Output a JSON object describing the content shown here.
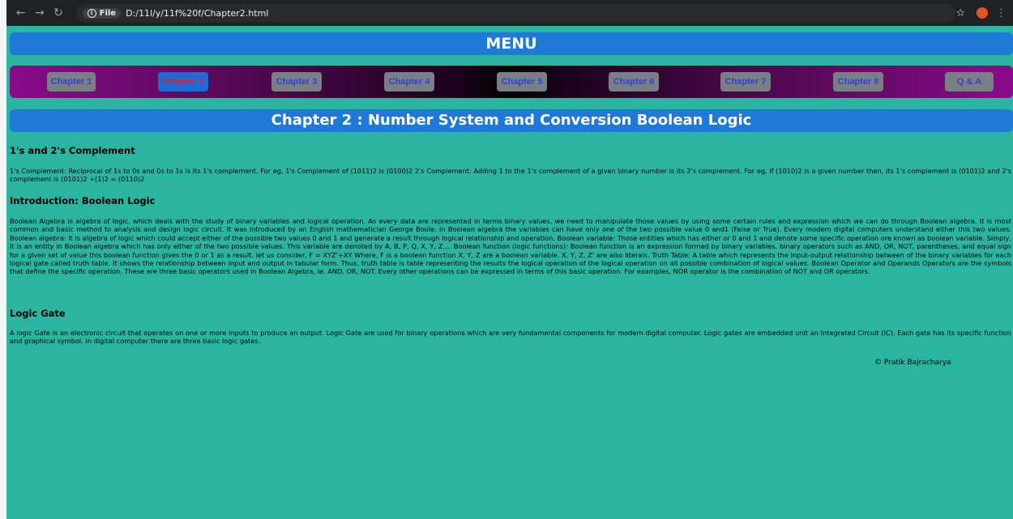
{
  "browser": {
    "file_label": "File",
    "url": "D:/11l/y/11f%20f/Chapter2.html"
  },
  "menu": {
    "title": "MENU"
  },
  "chapters": [
    {
      "label": "Chapter 1",
      "active": false
    },
    {
      "label": "Chapter 2",
      "active": true
    },
    {
      "label": "Chapter 3",
      "active": false
    },
    {
      "label": "Chapter 4",
      "active": false
    },
    {
      "label": "Chapter 5",
      "active": false
    },
    {
      "label": "Chapter 6",
      "active": false
    },
    {
      "label": "Chapter 7",
      "active": false
    },
    {
      "label": "Chapter 8",
      "active": false
    },
    {
      "label": "Q & A",
      "active": false
    }
  ],
  "page": {
    "title": "Chapter 2 : Number System and Conversion Boolean Logic"
  },
  "sections": [
    {
      "heading": "1's and 2's Complement",
      "body": "1's Complement: Reciprocal of 1s to 0s and 0s to 1s is its 1's complement. For eg, 1's Complement of (1011)2 is (0100)2 2's Complement: Adding 1 to the 1's complement of a given binary number is its 2's complement. For eg, if (1010)2 is a given number then, its 1's complement is (0101)2 and 2's complement is (0101)2 +(1)2 = (0110)2"
    },
    {
      "heading": "Introduction: Boolean Logic",
      "body": "Boolean Algebra is algebra of logic, which deals with the study of binary variables and logical operation. As every data are represented in terms binary values, we need to manipulate those values by using some certain rules and expression which we can do through Boolean algebra. It is most common and basic method to analysis and design logic circuit. It was introduced by an English mathematician George Boole. In Boolean algebra the variables can have only one of the two possible value 0 and1 (False or True). Every modern digital computers understand either this two values. Boolean algebra: It is algebra of logic which could accept either of the possible two values 0 and 1 and generate a result through logical relationship and operation. Boolean variable: Those entities which has either or 0 and 1 and denote some specific operation ore known as boolean variable. Simply, it is an entity in Boolean algebra which has only either of the two possible values. This variable are denoted by A, B, P, Q, X, Y, Z.... Boolean function (logic functions): Boolean function is an expression formed by binary variables, binary operators such as AND, OR, NOT, parentheses, and equal sign for a given set of value this boolean function gives the 0 or 1 as a result. let us consider, F = XYZ'+XY Where, F is a boolean function X, Y, Z are a boolean variable. X, Y, Z, Z' are also literals. Truth Table: A table which represents the input-output relationship between of the binary variables for each logical gate called truth table. It shows the relationship between input and output in tabular form. Thus, truth table is table representing the results the logical operation of the logical operation on all possible combination of logical values. Boolean Operator and Operands Operators are the symbols that define the specific operation. These are three basic operators used in Boolean Algebra, ie. AND, OR, NOT. Every other operations can be expressed in terms of this basic operation. For examples, NOR operator is the combination of NOT and OR operators."
    },
    {
      "heading": "Logic Gate",
      "body": "A logic Gate is an electronic circuit that operates on one or more inputs to produce an output. Logic Gate are used for binary operations which are very fundamental components for modern digital computer. Logic gates are embedded unit an Integrated Circuit (IC). Each gate has its specific function and graphical symbol. In digital computer there are three basic logic gates."
    }
  ],
  "footer": {
    "copyright": "© Pratik Bajracharya"
  }
}
